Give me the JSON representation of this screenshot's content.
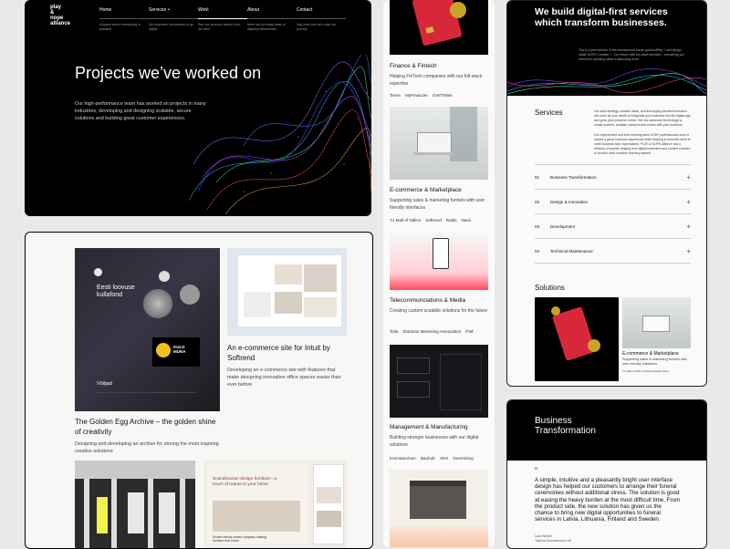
{
  "hero": {
    "logo_lines": [
      "play",
      "&",
      "nope",
      "alliance"
    ],
    "nav": [
      {
        "label": "Home",
        "desc": "A space where everything is possible"
      },
      {
        "label": "Services +",
        "desc": "We empower businesses to go digital"
      },
      {
        "label": "Work",
        "desc": "See our success stories from the field"
      },
      {
        "label": "About",
        "desc": "Meet our full stack team of digital professionals"
      },
      {
        "label": "Contact",
        "desc": "Say hello and let's start our journey"
      }
    ],
    "title": "Projects we’ve worked on",
    "body": "Our high-performance team has worked on projects in many industries, developing and designing scalable, secure solutions and building great customer experiences."
  },
  "projects": {
    "items": [
      {
        "title": "The Golden Egg Archive – the golden shine of creativity",
        "desc": "Designing and developing an archive for storing the most inspiring creative solutions",
        "thumb_text": "Eesti loovuse kullafond",
        "thumb_sub": "Võitjad",
        "badge": "KULD MUNA"
      },
      {
        "title": "An e-commerce site for Intuit by Softrend",
        "desc": "Developing an e-commerce site with features that make designing innovative office spaces easier than ever before"
      },
      {
        "thumb_text": "Scandinavian design furniture– a touch of nature in your home",
        "thumb_sub": "Modern family owned company making furniture that exists"
      }
    ]
  },
  "industries": [
    {
      "title": "Finance & Fintech",
      "desc": "Helping FinTech companies with our full-stack expertise",
      "tags": [
        "Tavex",
        "MyFinancier",
        "GetITWise"
      ]
    },
    {
      "title": "E-commerce & Marketplace",
      "desc": "Supporting sales & marketing funnels with user friendly interfaces",
      "tags": [
        "T1 Mall of Tallinn",
        "Softrend",
        "Radis",
        "Naos"
      ]
    },
    {
      "title": "Telecommunciations & Media",
      "desc": "Creating custom scalable solutions for the future",
      "tags": [
        "Telia",
        "Estonian Marketing Association",
        "PIM"
      ]
    },
    {
      "title": "Management & Manufacturing",
      "desc": "Building stronger businesses with our digital solutions",
      "tags": [
        "Krematoorium",
        "Bauhub",
        "VKG",
        "Geomining"
      ]
    }
  ],
  "services": {
    "title": "We build digital-first services which transform businesses.",
    "intro": "This is a joint venture of the development house gotoAndPlay + and design studio NOPE Creative + . Our teams offer full-stack services – everything you need from sprinting ideas to launching them.",
    "section_label": "Services",
    "desc1": "Our solid strategy, creative ideas, and thoroughly planned execution will cover all your needs to invigorate your business into the digital age and grow your presence online. We use advanced technology to create modern, scalable solutions that evolve with your business.",
    "desc2": "Our experienced and ever-learning team of 35+ professionals work to ensure a great customer experience while keeping in mind the need to meet business side expectations. PLAY & NOPE Alliance has a network of experts ranging from digital marketers and content creators to Nordic's best machine learning experts.",
    "rows": [
      {
        "num": "01",
        "name": "Business Transformation"
      },
      {
        "num": "02",
        "name": "Design & Innovation"
      },
      {
        "num": "03",
        "name": "Development"
      },
      {
        "num": "04",
        "name": "Technical Maintenance"
      }
    ],
    "solutions_label": "Solutions",
    "solution_card": {
      "title": "E-commerce & Marketplace",
      "desc": "Supporting sales & marketing funnels with user friendly interfaces",
      "tags": "T1 Mall of Tallinn   Softrend   Radis   Naos"
    }
  },
  "business": {
    "title_line1": "Business",
    "title_line2": "Transformation",
    "quote_mark": "“",
    "quote": "A simple, intuitive and a pleasantly bright user interface design has helped our customers to arrange their funeral ceremonies without additional stress. The solution is good at easing the heavy burden at the most difficult time. From the product side, the new solution has given us the chance to bring new digital opportunities to funeral services in Latvia, Lithuania, Finland and Sweden.",
    "author": "Lauri Nõmm",
    "author_role": "Tallinna Krematoorium AS"
  },
  "colors": {
    "dark": "#000000",
    "light": "#fafafa",
    "accent_red": "#d9273a",
    "gold": "#c9a227"
  }
}
